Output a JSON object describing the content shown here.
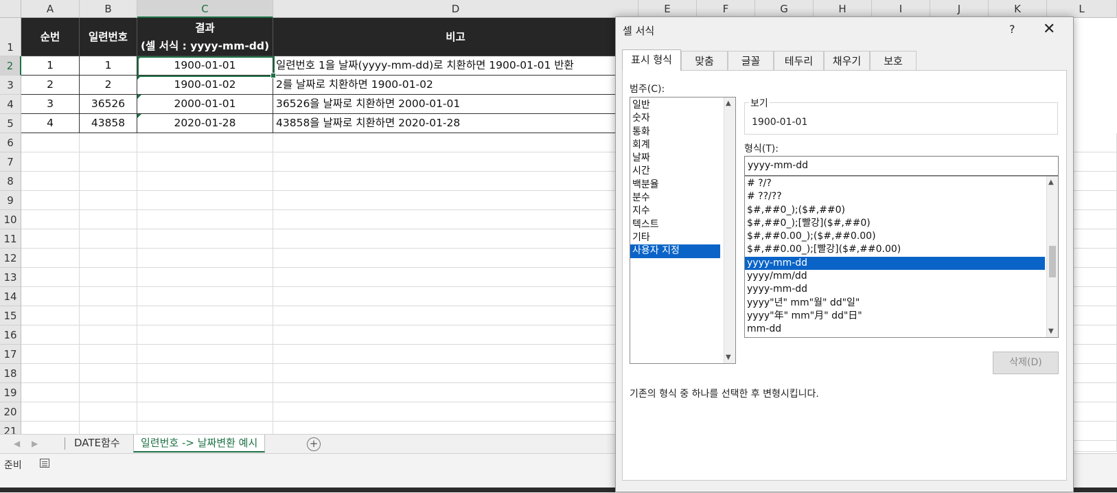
{
  "sheet": {
    "columns": [
      "A",
      "B",
      "C",
      "D",
      "E",
      "F",
      "G",
      "H",
      "I",
      "J",
      "K",
      "L"
    ],
    "rows": [
      "1",
      "2",
      "3",
      "4",
      "5",
      "6",
      "7",
      "8",
      "9",
      "10",
      "11",
      "12",
      "13",
      "14",
      "15",
      "16",
      "17",
      "18",
      "19",
      "20",
      "21"
    ],
    "header": {
      "seq": "순번",
      "serial": "일련번호",
      "result_line1": "결과",
      "result_line2": "(셀 서식 : yyyy-mm-dd)",
      "note": "비고"
    },
    "data_rows": [
      {
        "seq": "1",
        "serial": "1",
        "result": "1900-01-01",
        "note": "일련번호 1을 날짜(yyyy-mm-dd)로 치환하면 1900-01-01 반환"
      },
      {
        "seq": "2",
        "serial": "2",
        "result": "1900-01-02",
        "note": "2를 날짜로 치환하면 1900-01-02"
      },
      {
        "seq": "3",
        "serial": "36526",
        "result": "2000-01-01",
        "note": "36526을 날짜로 치환하면 2000-01-01"
      },
      {
        "seq": "4",
        "serial": "43858",
        "result": "2020-01-28",
        "note": "43858을 날짜로 치환하면 2020-01-28"
      }
    ],
    "active_cell": "C2",
    "accent_color": "#1e7145"
  },
  "sheet_tabs": {
    "tabs": [
      "DATE함수",
      "일련번호 -> 날짜변환 예시"
    ],
    "active_index": 1,
    "add_sheet": "+"
  },
  "statusbar": {
    "ready": "준비"
  },
  "dialog": {
    "title": "셀 서식",
    "help": "?",
    "close": "✕",
    "tabs": [
      "표시 형식",
      "맞춤",
      "글꼴",
      "테두리",
      "채우기",
      "보호"
    ],
    "active_tab": "표시 형식",
    "category_label": "범주(C):",
    "categories": [
      "일반",
      "숫자",
      "통화",
      "회계",
      "날짜",
      "시간",
      "백분율",
      "분수",
      "지수",
      "텍스트",
      "기타",
      "사용자 지정"
    ],
    "selected_category": "사용자 지정",
    "sample_label": "보기",
    "sample_value": "1900-01-01",
    "type_label": "형식(T):",
    "type_value": "yyyy-mm-dd",
    "formats": [
      "# ?/?",
      "# ??/??",
      "$#,##0_);($#,##0)",
      "$#,##0_);[빨강]($#,##0)",
      "$#,##0.00_);($#,##0.00)",
      "$#,##0.00_);[빨강]($#,##0.00)",
      "yyyy-mm-dd",
      "yyyy/mm/dd",
      "yyyy-mm-dd",
      "yyyy\"년\" mm\"월\" dd\"일\"",
      "yyyy\"年\" mm\"月\" dd\"日\"",
      "mm-dd"
    ],
    "selected_format_index": 6,
    "delete_button": "삭제(D)",
    "description": "기존의 형식 중 하나를 선택한 후 변형시킵니다.",
    "selection_color": "#0a64c8"
  }
}
